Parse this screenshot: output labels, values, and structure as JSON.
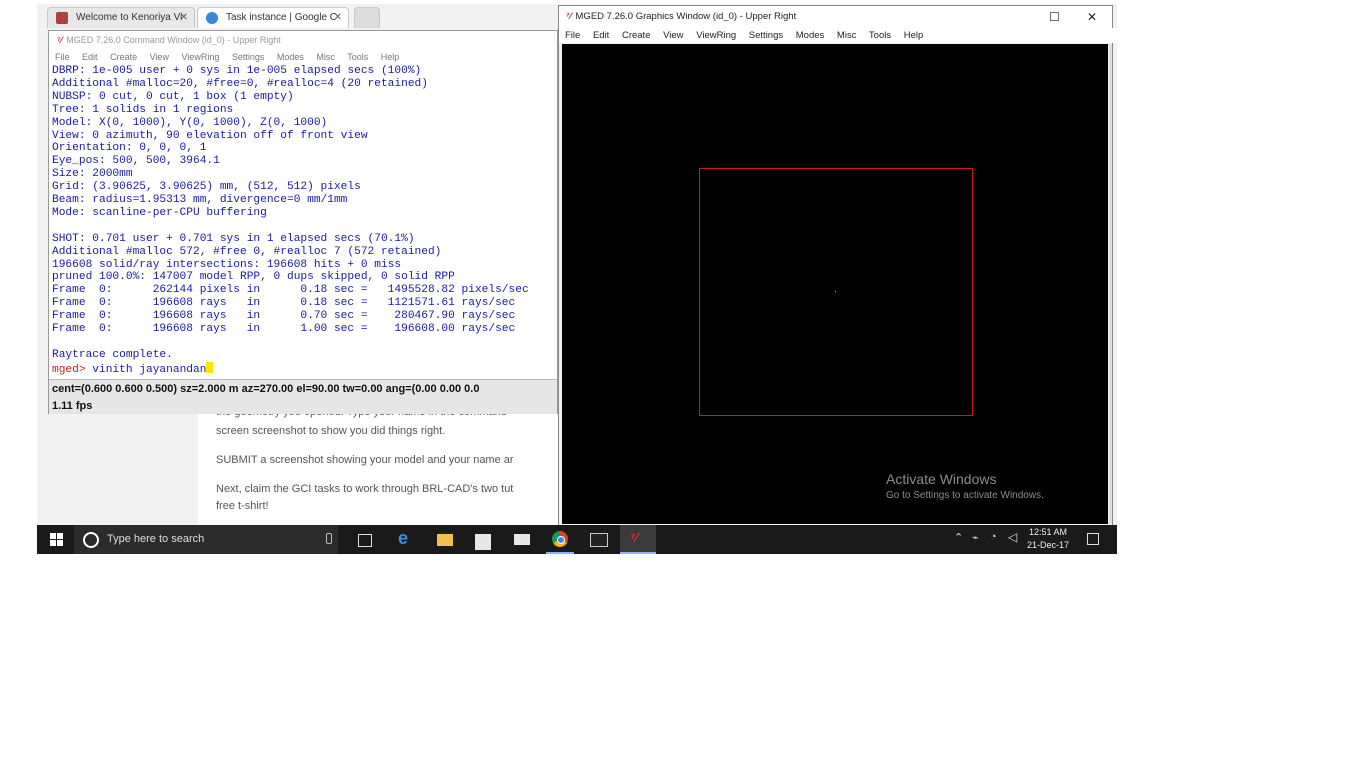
{
  "browser": {
    "tabs": [
      {
        "label": "Welcome to Kenoriya Vi",
        "active": false
      },
      {
        "label": "Task instance | Google C",
        "active": true
      }
    ],
    "page_lines": [
      "the geometry you opened. Type your name in the command",
      "screen screenshot to show you did things right.",
      "SUBMIT a screenshot showing your model and your name ar",
      "Next, claim the GCI tasks to work through BRL-CAD's two tut",
      "free t-shirt!"
    ]
  },
  "command_window": {
    "title": "MGED 7.26.0 Command Window (id_0) - Upper Right",
    "menu": [
      "File",
      "Edit",
      "Create",
      "View",
      "ViewRing",
      "Settings",
      "Modes",
      "Misc",
      "Tools",
      "Help"
    ],
    "output_lines": [
      "DBRP: 1e-005 user + 0 sys in 1e-005 elapsed secs (100%)",
      "Additional #malloc=20, #free=0, #realloc=4 (20 retained)",
      "NUBSP: 0 cut, 0 cut, 1 box (1 empty)",
      "Tree: 1 solids in 1 regions",
      "Model: X(0, 1000), Y(0, 1000), Z(0, 1000)",
      "View: 0 azimuth, 90 elevation off of front view",
      "Orientation: 0, 0, 0, 1",
      "Eye_pos: 500, 500, 3964.1",
      "Size: 2000mm",
      "Grid: (3.90625, 3.90625) mm, (512, 512) pixels",
      "Beam: radius=1.95313 mm, divergence=0 mm/1mm",
      "Mode: scanline-per-CPU buffering",
      "",
      "SHOT: 0.701 user + 0.701 sys in 1 elapsed secs (70.1%)",
      "Additional #malloc 572, #free 0, #realloc 7 (572 retained)",
      "196608 solid/ray intersections: 196608 hits + 0 miss",
      "pruned 100.0%: 147007 model RPP, 0 dups skipped, 0 solid RPP",
      "Frame  0:      262144 pixels in      0.18 sec =   1495528.82 pixels/sec",
      "Frame  0:      196608 rays   in      0.18 sec =   1121571.61 rays/sec",
      "Frame  0:      196608 rays   in      0.70 sec =    280467.90 rays/sec",
      "Frame  0:      196608 rays   in      1.00 sec =    196608.00 rays/sec",
      "",
      "Raytrace complete."
    ],
    "prompt": "mged>",
    "command": " vinith jayanandan",
    "status_line": "cent=(0.600 0.600 0.500) sz=2.000  m  az=270.00  el=90.00  tw=0.00  ang=(0.00 0.00 0.0",
    "fps": "1.11 fps"
  },
  "graphics_window": {
    "title": "MGED 7.26.0 Graphics Window (id_0) - Upper Right",
    "menu": [
      "File",
      "Edit",
      "Create",
      "View",
      "ViewRing",
      "Settings",
      "Modes",
      "Misc",
      "Tools",
      "Help"
    ],
    "minimize_glyph": "☐",
    "close_glyph": "✕",
    "activate_title": "Activate Windows",
    "activate_sub": "Go to Settings to activate Windows.",
    "box_color": "#d01818"
  },
  "taskbar": {
    "search_placeholder": "Type here to search",
    "time": "12:51 AM",
    "date": "21-Dec-17"
  }
}
